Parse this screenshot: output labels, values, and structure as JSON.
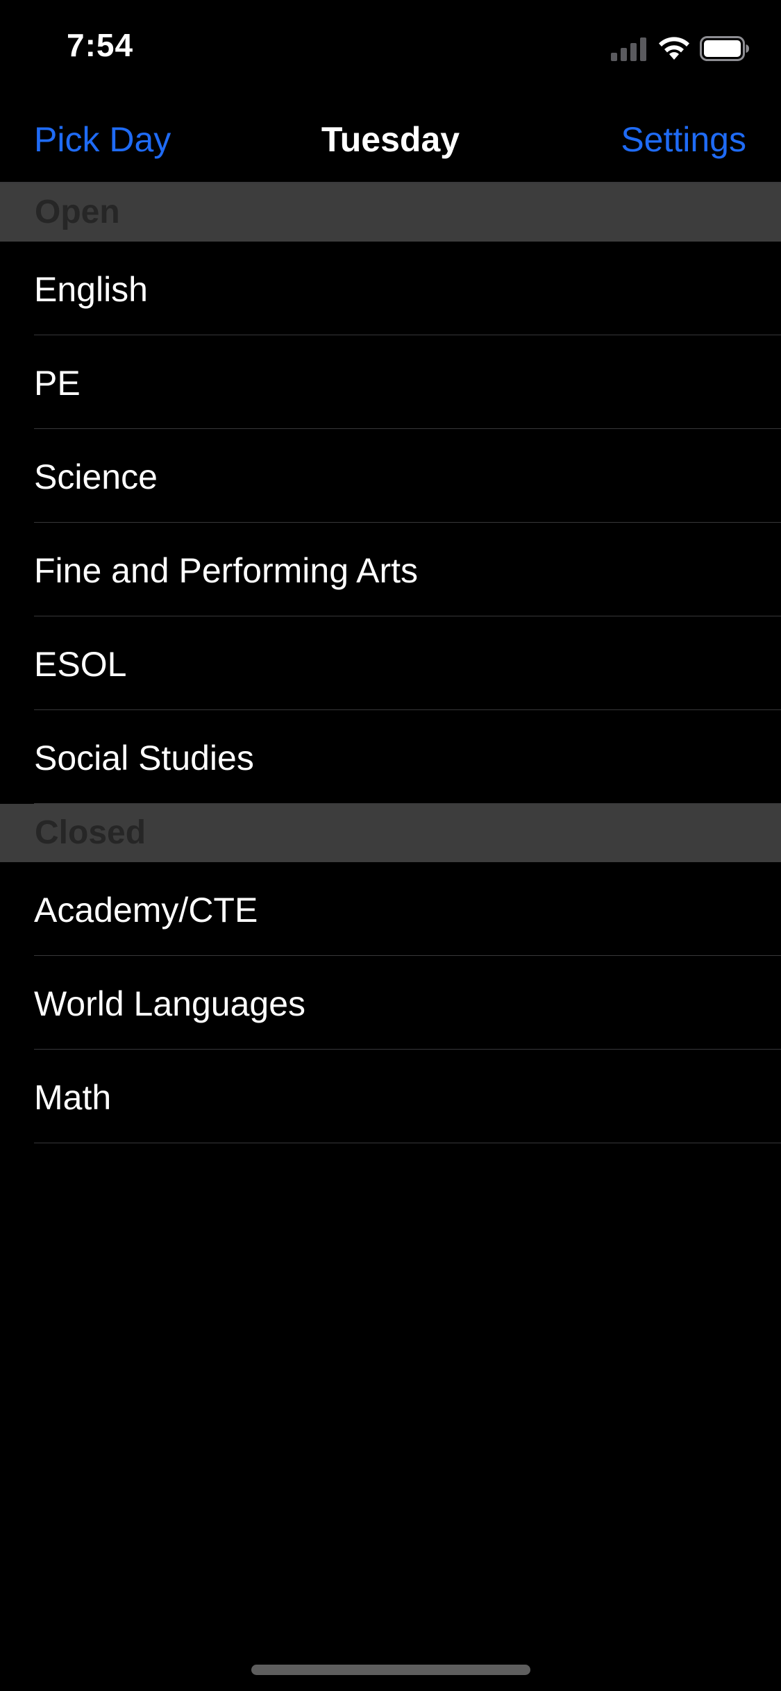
{
  "status_bar": {
    "time": "7:54"
  },
  "nav": {
    "left_label": "Pick Day",
    "title": "Tuesday",
    "right_label": "Settings",
    "accent_color": "#1f6bf5"
  },
  "sections": {
    "open": {
      "header": "Open",
      "items": [
        {
          "label": "English"
        },
        {
          "label": "PE"
        },
        {
          "label": "Science"
        },
        {
          "label": "Fine and Performing Arts"
        },
        {
          "label": "ESOL"
        },
        {
          "label": "Social Studies"
        }
      ]
    },
    "closed": {
      "header": "Closed",
      "items": [
        {
          "label": "Academy/CTE"
        },
        {
          "label": "World Languages"
        },
        {
          "label": "Math"
        }
      ]
    }
  },
  "icons": {
    "signal": "cellular-signal-icon",
    "wifi": "wifi-icon",
    "battery": "battery-icon"
  }
}
